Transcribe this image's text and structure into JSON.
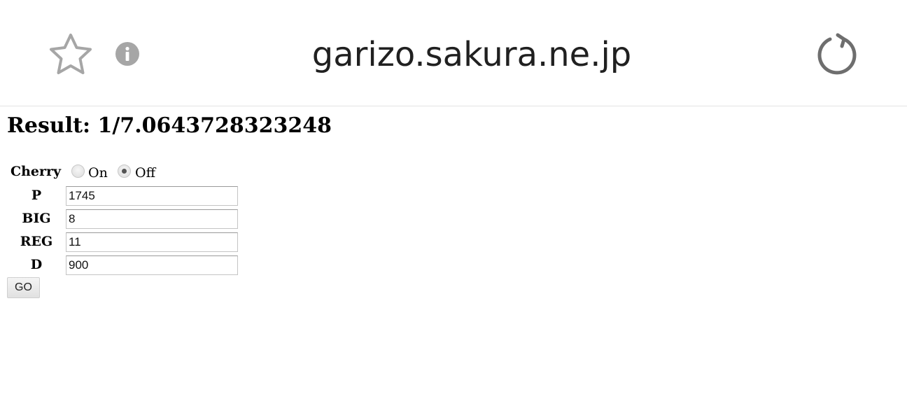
{
  "browser": {
    "url": "garizo.sakura.ne.jp",
    "icons": {
      "bookmark": "star-icon",
      "site_info": "info-icon",
      "reload": "reload-icon"
    }
  },
  "page": {
    "result_heading": "Result: 1/7.0643728323248",
    "form": {
      "cherry": {
        "label": "Cherry",
        "options": [
          {
            "label": "On",
            "selected": false
          },
          {
            "label": "Off",
            "selected": true
          }
        ]
      },
      "fields": [
        {
          "label": "P",
          "value": "1745"
        },
        {
          "label": "BIG",
          "value": "8"
        },
        {
          "label": "REG",
          "value": "11"
        },
        {
          "label": "D",
          "value": "900"
        }
      ],
      "submit_label": "GO"
    }
  }
}
